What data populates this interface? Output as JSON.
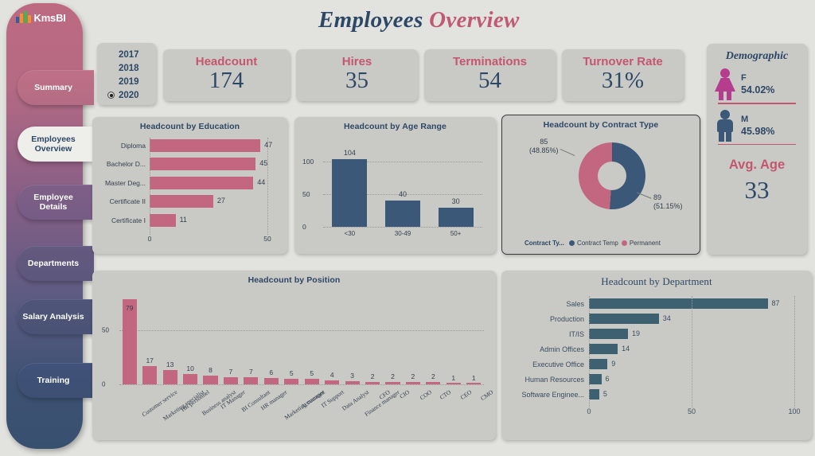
{
  "app": {
    "logo_text": "KmsBI",
    "background_color": "#e2e2de",
    "panel_color": "#c9c9c5",
    "accent_rose": "#c4576f",
    "accent_navy": "#2d4766"
  },
  "sidebar": {
    "items": [
      {
        "label": "Summary",
        "active": false
      },
      {
        "label": "Employees Overview",
        "active": true
      },
      {
        "label": "Employee Details",
        "active": false
      },
      {
        "label": "Departments",
        "active": false
      },
      {
        "label": "Salary Analysis",
        "active": false
      },
      {
        "label": "Training",
        "active": false
      }
    ]
  },
  "header": {
    "title_primary": "Employees",
    "title_secondary": "Overview"
  },
  "year_slicer": {
    "options": [
      {
        "label": "2017",
        "selected": false
      },
      {
        "label": "2018",
        "selected": false
      },
      {
        "label": "2019",
        "selected": false
      },
      {
        "label": "2020",
        "selected": true
      }
    ]
  },
  "kpis": [
    {
      "label": "Headcount",
      "value": "174"
    },
    {
      "label": "Hires",
      "value": "35"
    },
    {
      "label": "Terminations",
      "value": "54"
    },
    {
      "label": "Turnover Rate",
      "value": "31%"
    }
  ],
  "demographic": {
    "title": "Demographic",
    "female": {
      "letter": "F",
      "pct": "54.02%"
    },
    "male": {
      "letter": "M",
      "pct": "45.98%"
    },
    "avg_age_label": "Avg. Age",
    "avg_age_value": "33"
  },
  "chart_data": [
    {
      "id": "education",
      "type": "bar",
      "orientation": "horizontal",
      "title": "Headcount by Education",
      "categories": [
        "Diploma",
        "Bachelor D...",
        "Master Deg...",
        "Certificate II",
        "Certificate I"
      ],
      "values": [
        47,
        45,
        44,
        27,
        11
      ],
      "xlim": [
        0,
        50
      ],
      "xticks": [
        "0",
        "50"
      ],
      "color": "#c2677f",
      "grid": true
    },
    {
      "id": "age_range",
      "type": "bar",
      "orientation": "vertical",
      "title": "Headcount by Age Range",
      "categories": [
        "<30",
        "30-49",
        "50+"
      ],
      "values": [
        104,
        40,
        30
      ],
      "ylim": [
        0,
        110
      ],
      "yticks": [
        "0",
        "50",
        "100"
      ],
      "color": "#3c5878",
      "grid": true
    },
    {
      "id": "contract_type",
      "type": "pie",
      "variant": "donut",
      "title": "Headcount by Contract Type",
      "legend_title": "Contract Ty...",
      "legend_position": "bottom",
      "slices": [
        {
          "name": "Contract Temp",
          "value": 89,
          "pct": "51.15%",
          "label": "89",
          "pct_label": "(51.15%)",
          "color": "#3c5878"
        },
        {
          "name": "Permanent",
          "value": 85,
          "pct": "48.85%",
          "label": "85",
          "pct_label": "(48.85%)",
          "color": "#c2677f"
        }
      ]
    },
    {
      "id": "position",
      "type": "bar",
      "orientation": "vertical",
      "title": "Headcount by Position",
      "categories": [
        "Customer service",
        "Marketing specialist",
        "HR personnel",
        "Business analyst",
        "IT Manager",
        "BI Consultant",
        "HR manager",
        "Marketing manager",
        "Accountant",
        "IT Support",
        "Data Analyst",
        "Finance manager",
        "CFO",
        "CIO",
        "COO",
        "CTO",
        "CEO",
        "CMO"
      ],
      "values": [
        79,
        17,
        13,
        10,
        8,
        7,
        7,
        6,
        5,
        5,
        4,
        3,
        2,
        2,
        2,
        2,
        1,
        1
      ],
      "ylim": [
        0,
        85
      ],
      "yticks": [
        "0",
        "50"
      ],
      "color": "#c2677f",
      "grid": true
    },
    {
      "id": "department",
      "type": "bar",
      "orientation": "horizontal",
      "title": "Headcount by Department",
      "categories": [
        "Sales",
        "Production",
        "IT/IS",
        "Admin Offices",
        "Executive Office",
        "Human Resources",
        "Software Enginee..."
      ],
      "values": [
        87,
        34,
        19,
        14,
        9,
        6,
        5
      ],
      "xlim": [
        0,
        100
      ],
      "xticks": [
        "0",
        "50",
        "100"
      ],
      "color": "#3e6172",
      "grid": true
    }
  ]
}
